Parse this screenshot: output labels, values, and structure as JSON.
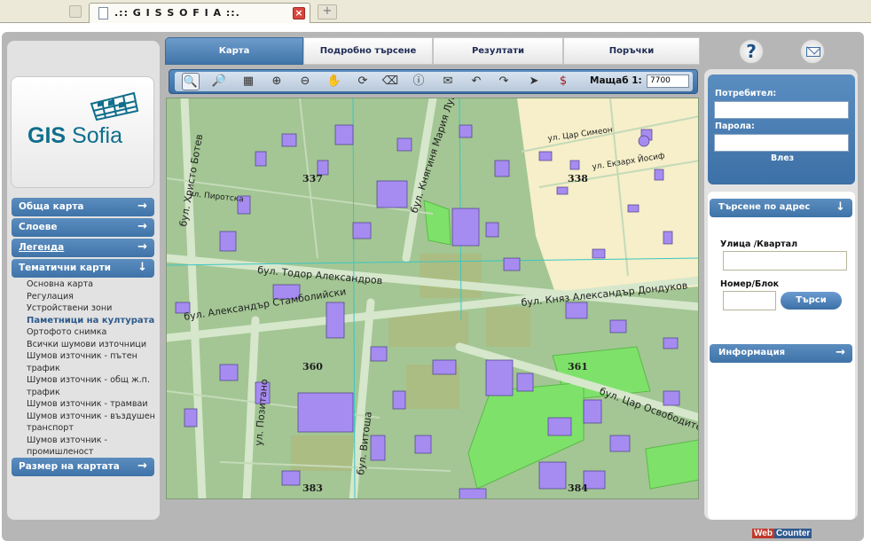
{
  "browser": {
    "tab_title": ".:: G I S S O F I A ::.",
    "close_glyph": "×",
    "new_tab_glyph": "+"
  },
  "logo": {
    "text_gis": "GIS",
    "text_sofia": " Sofia"
  },
  "left_menu": {
    "general_map": "Обща карта",
    "layers": "Слоеве",
    "legend": "Легенда",
    "thematic_maps": "Тематични карти",
    "map_size": "Размер на картата",
    "arrow_right": "→",
    "arrow_down": "↓",
    "thematic_items": [
      "Основна карта",
      "Регулация",
      "Устройствени зони",
      "Паметници на културата",
      "Ортофото снимка",
      "Всички шумови източници",
      "Шумов източник - пътен трафик",
      "Шумов източник - общ ж.п. трафик",
      "Шумов източник - трамваи",
      "Шумов източник - въздушен транспорт",
      "Шумов източник - промишленост"
    ],
    "active_item_index": 3
  },
  "tabs": [
    "Карта",
    "Подробно търсене",
    "Резултати",
    "Поръчки"
  ],
  "toolbar": {
    "tools": [
      "zoom-in-rect-icon",
      "zoom-out-rect-icon",
      "extent-icon",
      "zoom-in-icon",
      "zoom-out-icon",
      "pan-hand-icon",
      "refresh-icon",
      "eraser-icon",
      "info-icon",
      "mail-icon",
      "back-icon",
      "forward-icon",
      "pointer-icon",
      "price-icon"
    ],
    "scale_label": "Мащаб 1:",
    "scale_value": "7700"
  },
  "map": {
    "block_labels": [
      "337",
      "338",
      "360",
      "361",
      "383",
      "384"
    ],
    "streets": [
      "бул. Тодор Александров",
      "бул. Александър Стамболийски",
      "бул. Княз Александър Дондуков",
      "бул. Цар Освободител",
      "бул. Витоша",
      "ул. Позитано",
      "бул. Христо Ботев",
      "бул. Княгиня Мария Луиза",
      "ул. Цар Симеон",
      "ул. Екзарх Йосиф",
      "ул. Пиротска"
    ]
  },
  "header_buttons": {
    "help": "?"
  },
  "login": {
    "user_label": "Потребител:",
    "password_label": "Парола:",
    "submit": "Влез"
  },
  "address_search": {
    "title": "Търсене по адрес",
    "street_label": "Улица /Квартал",
    "number_label": "Номер/Блок",
    "search_button": "Търси",
    "info_title": "Информация"
  },
  "webcounter": {
    "part1": "Web",
    "part2": "Counter"
  },
  "colors": {
    "accent": "#3f73a8",
    "map_green": "#a3c694",
    "park_green": "#7ee26a",
    "building_purple": "#a68cf0",
    "old_town_beige": "#f6efc9"
  }
}
